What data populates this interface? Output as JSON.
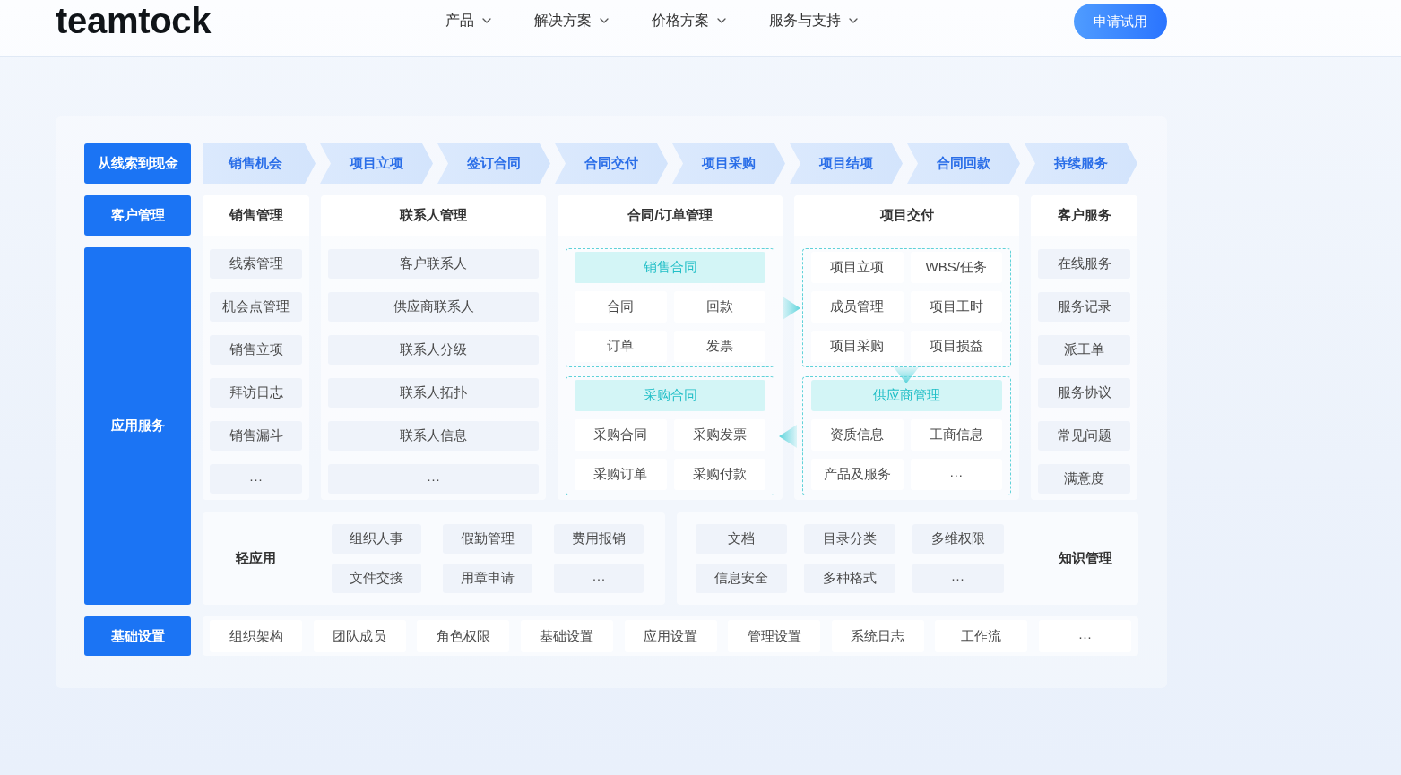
{
  "header": {
    "logo": "teamtock",
    "nav": [
      {
        "label": "产品"
      },
      {
        "label": "解决方案"
      },
      {
        "label": "价格方案"
      },
      {
        "label": "服务与支持"
      }
    ],
    "cta": "申请试用"
  },
  "flow_row": {
    "label": "从线索到现金",
    "steps": [
      "销售机会",
      "项目立项",
      "签订合同",
      "合同交付",
      "项目采购",
      "项目结项",
      "合同回款",
      "持续服务"
    ]
  },
  "module_row": {
    "label": "客户管理",
    "modules": [
      {
        "title": "销售管理",
        "kind": "list",
        "items": [
          "线索管理",
          "机会点管理",
          "销售立项",
          "拜访日志",
          "销售漏斗",
          "···"
        ]
      },
      {
        "title": "联系人管理",
        "kind": "list",
        "items": [
          "客户联系人",
          "供应商联系人",
          "联系人分级",
          "联系人拓扑",
          "联系人信息",
          "···"
        ]
      },
      {
        "title": "合同/订单管理",
        "kind": "groups",
        "groups": [
          {
            "title": "销售合同",
            "items": [
              "合同",
              "回款",
              "订单",
              "发票"
            ]
          },
          {
            "title": "采购合同",
            "items": [
              "采购合同",
              "采购发票",
              "采购订单",
              "采购付款"
            ]
          }
        ]
      },
      {
        "title": "项目交付",
        "kind": "groups",
        "groups": [
          {
            "items": [
              "项目立项",
              "WBS/任务",
              "成员管理",
              "项目工时",
              "项目采购",
              "项目损益"
            ]
          },
          {
            "title": "供应商管理",
            "items": [
              "资质信息",
              "工商信息",
              "产品及服务",
              "···"
            ]
          }
        ]
      },
      {
        "title": "客户服务",
        "kind": "list",
        "items": [
          "在线服务",
          "服务记录",
          "派工单",
          "服务协议",
          "常见问题",
          "满意度"
        ]
      }
    ]
  },
  "app_row": {
    "label": "应用服务",
    "light_apps": {
      "label": "轻应用",
      "items": [
        "组织人事",
        "假勤管理",
        "费用报销",
        "文件交接",
        "用章申请",
        "···"
      ]
    },
    "knowledge": {
      "label": "知识管理",
      "items": [
        "文档",
        "目录分类",
        "多维权限",
        "信息安全",
        "多种格式",
        "···"
      ]
    }
  },
  "base_row": {
    "label": "基础设置",
    "items": [
      "组织架构",
      "团队成员",
      "角色权限",
      "基础设置",
      "应用设置",
      "管理设置",
      "系统日志",
      "工作流",
      "···"
    ]
  }
}
